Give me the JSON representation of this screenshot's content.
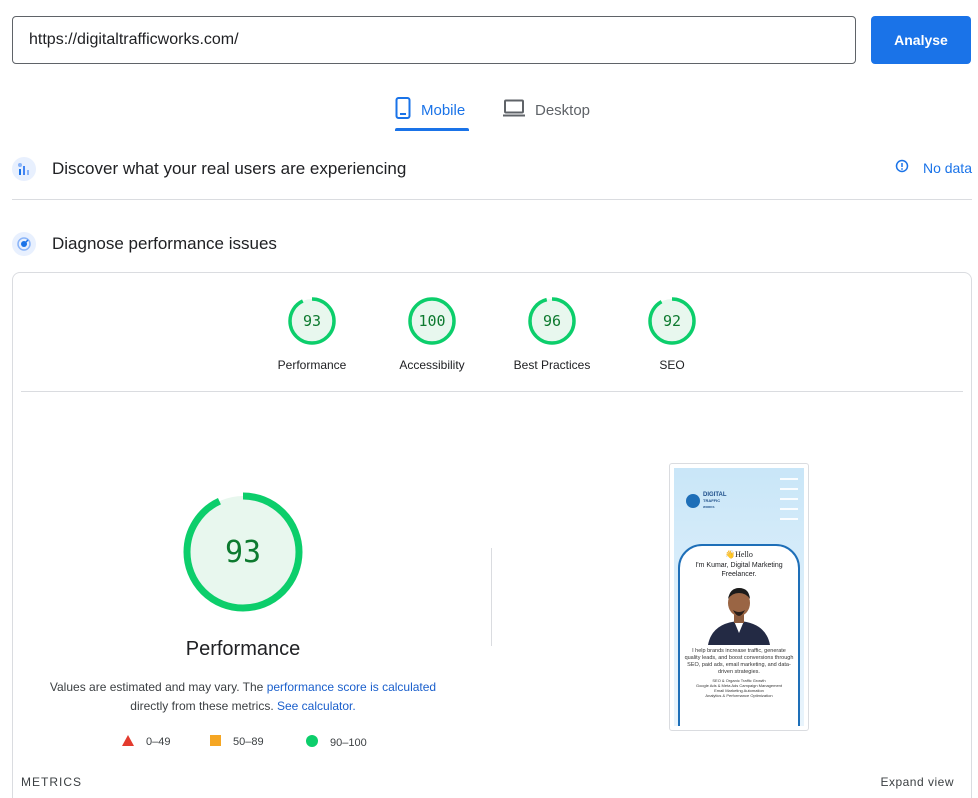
{
  "search": {
    "url_value": "https://digitaltrafficworks.com/",
    "button_label": "Analyse"
  },
  "tabs": [
    {
      "label": "Mobile",
      "icon": "mobile-icon",
      "active": true
    },
    {
      "label": "Desktop",
      "icon": "desktop-icon",
      "active": false
    }
  ],
  "field_data": {
    "title": "Discover what your real users are experiencing",
    "status": "No data"
  },
  "lab": {
    "title": "Diagnose performance issues"
  },
  "categories": [
    {
      "score": "93",
      "label": "Performance"
    },
    {
      "score": "100",
      "label": "Accessibility"
    },
    {
      "score": "96",
      "label": "Best Practices"
    },
    {
      "score": "92",
      "label": "SEO"
    }
  ],
  "performance": {
    "score": "93",
    "label": "Performance",
    "desc_1": "Values are estimated and may vary. The",
    "link_1": "performance score is calculated",
    "desc_2": "directly from these metrics.",
    "link_2": "See calculator."
  },
  "legend": [
    {
      "range": "0–49",
      "color": "#e33b2e"
    },
    {
      "range": "50–89",
      "color": "#f5a623"
    },
    {
      "range": "90–100",
      "color": "#0cce6b"
    }
  ],
  "screenshot": {
    "logo_line1": "DIGITAL",
    "logo_line2": "TRAFFIC",
    "logo_line3": "WORKS",
    "hello": "👋Hello",
    "heading": "I'm Kumar, Digital Marketing Freelancer.",
    "body": "I help brands increase traffic, generate quality leads, and boost conversions through SEO, paid ads, email marketing, and data-driven strategies.",
    "bullets": [
      "SEO & Organic Traffic Growth",
      "Google Ads & Meta Ads Campaign Management",
      "Email Marketing Automation",
      "Analytics & Performance Optimization"
    ]
  },
  "metrics": {
    "label": "METRICS",
    "expand_label": "Expand view"
  },
  "colors": {
    "accent": "#1a73e8",
    "good": "#0cce6b",
    "good_text": "#0d7a2f"
  }
}
